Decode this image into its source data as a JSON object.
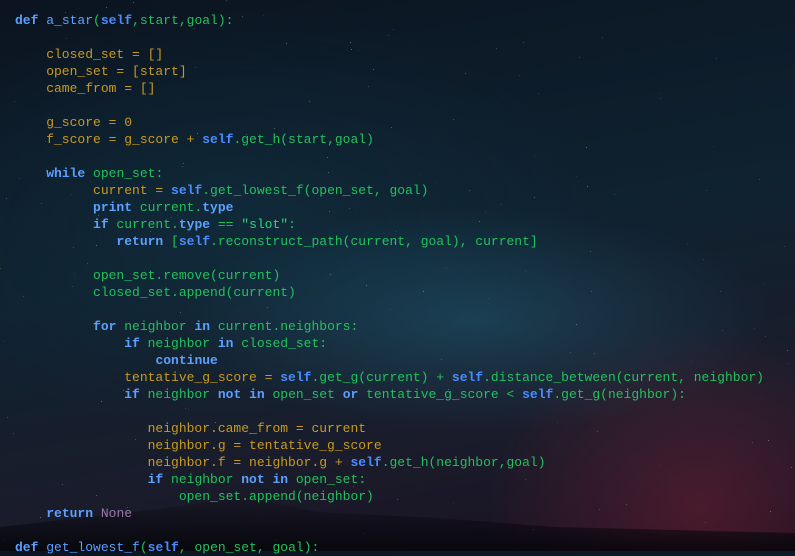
{
  "colors": {
    "keyword": "#5ba0ff",
    "self": "#4a8bff",
    "variable": "#c89a20",
    "plain": "#21c25b",
    "string": "#38d17a",
    "none": "#9a76a8"
  },
  "lines": [
    [
      {
        "t": "def",
        "c": "keyword"
      },
      {
        "t": " ",
        "c": "plain"
      },
      {
        "t": "a_star",
        "c": "func"
      },
      {
        "t": "(",
        "c": "plain"
      },
      {
        "t": "self",
        "c": "self"
      },
      {
        "t": ",start,goal):",
        "c": "plain"
      }
    ],
    [],
    [
      {
        "t": "    closed_set = []",
        "c": "var"
      }
    ],
    [
      {
        "t": "    open_set = [start]",
        "c": "var"
      }
    ],
    [
      {
        "t": "    came_from = []",
        "c": "var"
      }
    ],
    [],
    [
      {
        "t": "    g_score = 0",
        "c": "var"
      }
    ],
    [
      {
        "t": "    f_score = g_score + ",
        "c": "var"
      },
      {
        "t": "self",
        "c": "self"
      },
      {
        "t": ".get_h(start,goal)",
        "c": "plain"
      }
    ],
    [],
    [
      {
        "t": "    ",
        "c": "plain"
      },
      {
        "t": "while",
        "c": "keyword"
      },
      {
        "t": " open_set:",
        "c": "plain"
      }
    ],
    [
      {
        "t": "          current = ",
        "c": "var"
      },
      {
        "t": "self",
        "c": "self"
      },
      {
        "t": ".get_lowest_f(open_set, goal)",
        "c": "plain"
      }
    ],
    [
      {
        "t": "          ",
        "c": "plain"
      },
      {
        "t": "print",
        "c": "keyword"
      },
      {
        "t": " current.",
        "c": "plain"
      },
      {
        "t": "type",
        "c": "keyword"
      }
    ],
    [
      {
        "t": "          ",
        "c": "plain"
      },
      {
        "t": "if",
        "c": "keyword"
      },
      {
        "t": " current.",
        "c": "plain"
      },
      {
        "t": "type",
        "c": "keyword"
      },
      {
        "t": " == ",
        "c": "plain"
      },
      {
        "t": "\"slot\"",
        "c": "string"
      },
      {
        "t": ":",
        "c": "plain"
      }
    ],
    [
      {
        "t": "             ",
        "c": "plain"
      },
      {
        "t": "return",
        "c": "keyword"
      },
      {
        "t": " [",
        "c": "plain"
      },
      {
        "t": "self",
        "c": "self"
      },
      {
        "t": ".reconstruct_path(current, goal), current]",
        "c": "plain"
      }
    ],
    [],
    [
      {
        "t": "          open_set.remove(current)",
        "c": "plain"
      }
    ],
    [
      {
        "t": "          closed_set.append(current)",
        "c": "plain"
      }
    ],
    [],
    [
      {
        "t": "          ",
        "c": "plain"
      },
      {
        "t": "for",
        "c": "keyword"
      },
      {
        "t": " neighbor ",
        "c": "plain"
      },
      {
        "t": "in",
        "c": "keyword"
      },
      {
        "t": " current.neighbors:",
        "c": "plain"
      }
    ],
    [
      {
        "t": "              ",
        "c": "plain"
      },
      {
        "t": "if",
        "c": "keyword"
      },
      {
        "t": " neighbor ",
        "c": "plain"
      },
      {
        "t": "in",
        "c": "keyword"
      },
      {
        "t": " closed_set:",
        "c": "plain"
      }
    ],
    [
      {
        "t": "                  ",
        "c": "plain"
      },
      {
        "t": "continue",
        "c": "keyword"
      }
    ],
    [
      {
        "t": "              tentative_g_score = ",
        "c": "var"
      },
      {
        "t": "self",
        "c": "self"
      },
      {
        "t": ".get_g(current) + ",
        "c": "plain"
      },
      {
        "t": "self",
        "c": "self"
      },
      {
        "t": ".distance_between(current, neighbor)",
        "c": "plain"
      }
    ],
    [
      {
        "t": "              ",
        "c": "plain"
      },
      {
        "t": "if",
        "c": "keyword"
      },
      {
        "t": " neighbor ",
        "c": "plain"
      },
      {
        "t": "not",
        "c": "keyword"
      },
      {
        "t": " ",
        "c": "plain"
      },
      {
        "t": "in",
        "c": "keyword"
      },
      {
        "t": " open_set ",
        "c": "plain"
      },
      {
        "t": "or",
        "c": "keyword"
      },
      {
        "t": " tentative_g_score < ",
        "c": "plain"
      },
      {
        "t": "self",
        "c": "self"
      },
      {
        "t": ".get_g(neighbor):",
        "c": "plain"
      }
    ],
    [],
    [
      {
        "t": "                 neighbor.came_from = current",
        "c": "var"
      }
    ],
    [
      {
        "t": "                 neighbor.g = tentative_g_score",
        "c": "var"
      }
    ],
    [
      {
        "t": "                 neighbor.f = neighbor.g + ",
        "c": "var"
      },
      {
        "t": "self",
        "c": "self"
      },
      {
        "t": ".get_h(neighbor,goal)",
        "c": "plain"
      }
    ],
    [
      {
        "t": "                 ",
        "c": "plain"
      },
      {
        "t": "if",
        "c": "keyword"
      },
      {
        "t": " neighbor ",
        "c": "plain"
      },
      {
        "t": "not",
        "c": "keyword"
      },
      {
        "t": " ",
        "c": "plain"
      },
      {
        "t": "in",
        "c": "keyword"
      },
      {
        "t": " open_set:",
        "c": "plain"
      }
    ],
    [
      {
        "t": "                     open_set.append(neighbor)",
        "c": "plain"
      }
    ],
    [
      {
        "t": "    ",
        "c": "plain"
      },
      {
        "t": "return",
        "c": "keyword"
      },
      {
        "t": " ",
        "c": "plain"
      },
      {
        "t": "None",
        "c": "none"
      }
    ],
    [],
    [
      {
        "t": "def",
        "c": "keyword"
      },
      {
        "t": " ",
        "c": "plain"
      },
      {
        "t": "get_lowest_f",
        "c": "func"
      },
      {
        "t": "(",
        "c": "plain"
      },
      {
        "t": "self",
        "c": "self"
      },
      {
        "t": ", open_set, goal):",
        "c": "plain"
      }
    ]
  ]
}
